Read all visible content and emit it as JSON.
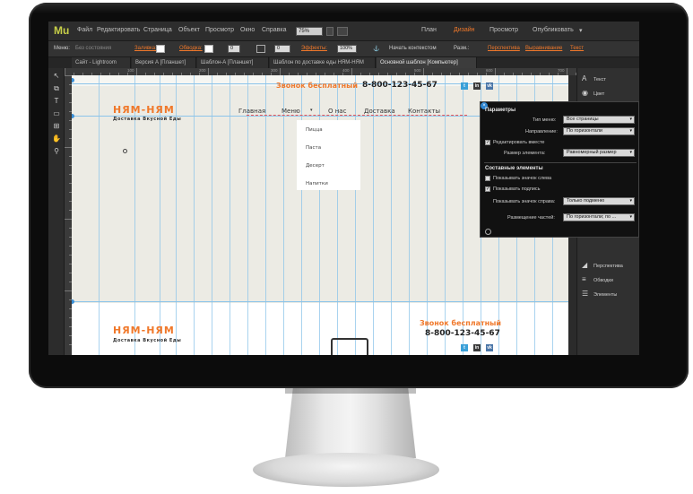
{
  "app": {
    "logo": "Mu",
    "menu": [
      "Файл",
      "Редактировать",
      "Страница",
      "Объект",
      "Просмотр",
      "Окно",
      "Справка"
    ],
    "zoom": "75%",
    "modes": [
      "План",
      "Дизайн",
      "Просмотр",
      "Опубликовать"
    ],
    "active_mode": "Дизайн",
    "publish_arrow": "▾"
  },
  "options_bar": {
    "state_label": "Меню:",
    "state_value": "Без состояния",
    "fill_label": "Заливка:",
    "stroke_label": "Обводка:",
    "stroke_value": "0",
    "effects_label": "Эффекты:",
    "opacity_value": "100%",
    "hide_header_label": "Начать контекстом",
    "size_label": "Разм.:",
    "links": [
      "Перспектива",
      "Выравнивание",
      "Текст"
    ]
  },
  "tabs": [
    "Сайт - Lightroom",
    "Версия А [Планшет]",
    "Шаблон-А [Планшет]",
    "Шаблон по доставке еды НЯМ-НЯМ",
    "Основной шаблон [Компьютер]"
  ],
  "tools": [
    "cursor-icon",
    "hand-icon",
    "text-icon",
    "rectangle-icon",
    "frame-icon",
    "zoom-icon"
  ],
  "ruler_numbers": [
    "100",
    "200",
    "300",
    "400",
    "500",
    "600",
    "700"
  ],
  "site": {
    "brand": "НЯМ-НЯМ",
    "tagline": "Доставка Вкусной Еды",
    "call_label": "Звонок бесплатный",
    "phone": "8-800-123-45-67",
    "nav": [
      "Главная",
      "Меню",
      "О нас",
      "Доставка",
      "Контакты"
    ],
    "nav_dropdown_marker": "▾",
    "dropdown": [
      "Пицца",
      "Паста",
      "Десерт",
      "Напитки"
    ],
    "social": [
      "t",
      "in",
      "vk"
    ],
    "footer_brand": "НЯМ-НЯМ",
    "footer_tagline": "Доставка Вкусной Еды",
    "footer_call": "Звонок бесплатный",
    "footer_phone": "8-800-123-45-67"
  },
  "popup": {
    "params_title": "Параметры",
    "type_label": "Тип меню:",
    "type_value": "Все страницы",
    "direction_label": "Направление:",
    "direction_value": "По горизонтали",
    "edit_together_label": "Редактировать вместе",
    "size_label": "Размер элемента:",
    "size_value": "Равномерный размер",
    "components_title": "Составные элементы",
    "show_icon_label": "Показывать значок слева",
    "show_caption_label": "Показывать подпись",
    "show_right_label": "Показывать значок справа:",
    "show_right_value": "Только подменю",
    "placement_label": "Размещение частей:",
    "placement_value": "По горизонтали; по ..."
  },
  "right_panel": {
    "top": [
      {
        "icon": "text-A-icon",
        "label": "Текст"
      },
      {
        "icon": "color-icon",
        "label": "Цвет"
      }
    ],
    "bottom": [
      {
        "icon": "perspective-icon",
        "label": "Перспектива"
      },
      {
        "icon": "strokes-icon",
        "label": "Обводки"
      },
      {
        "icon": "layers-icon",
        "label": "Элементы"
      }
    ]
  },
  "colors": {
    "accent": "#f0782a",
    "guide": "#8cc4ea",
    "canvas_bg": "#ecebe4"
  }
}
